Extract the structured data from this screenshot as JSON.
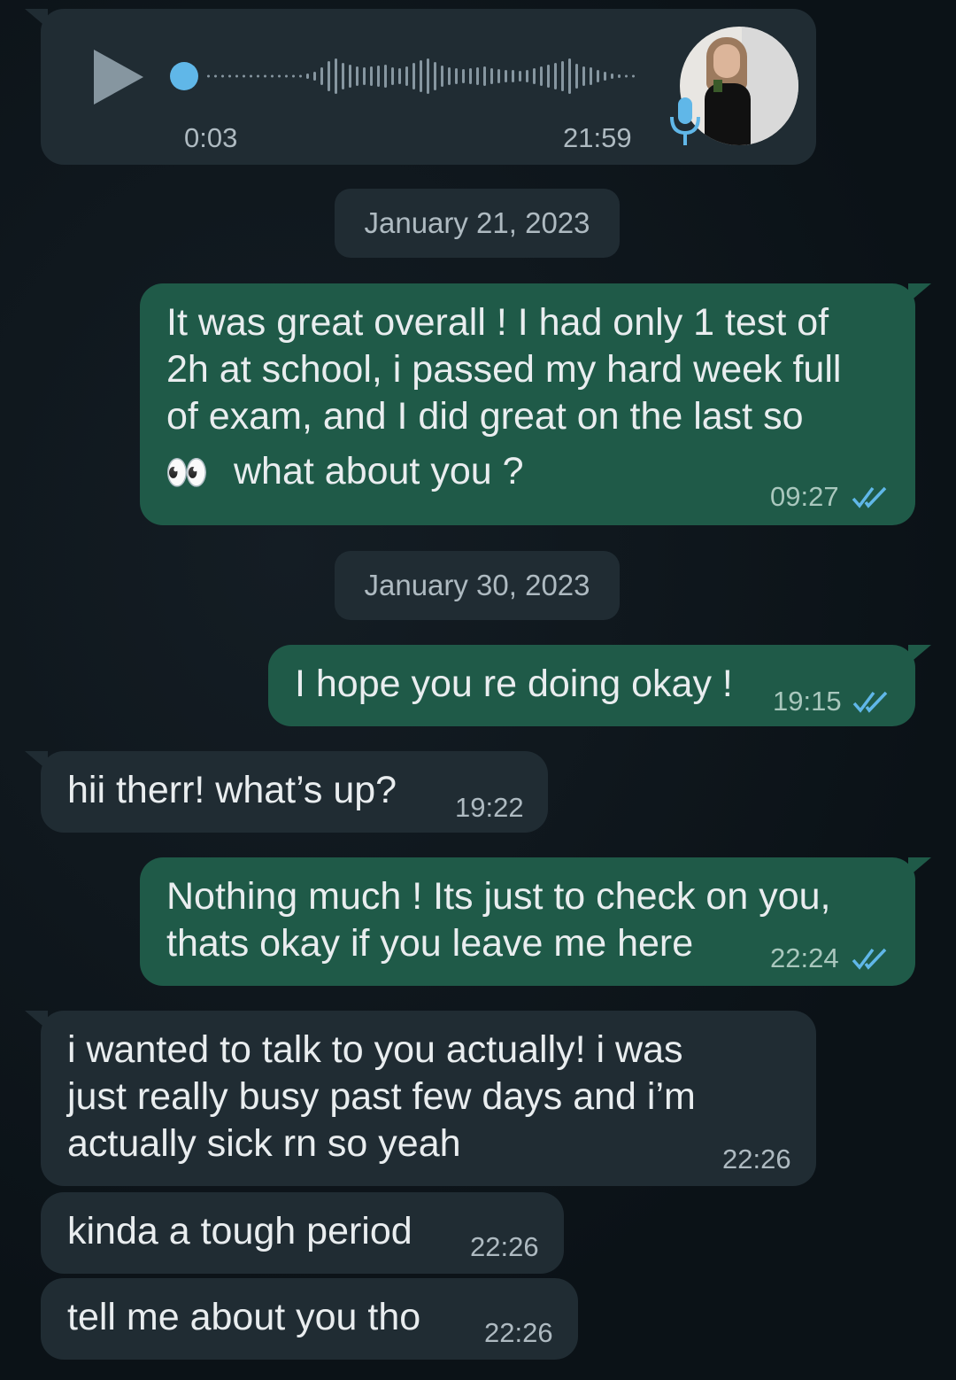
{
  "voice_message": {
    "duration": "0:03",
    "time": "21:59",
    "colors": {
      "accent": "#60b7e8",
      "bubble": "#202c33"
    },
    "icons": [
      "play-icon",
      "microphone-icon"
    ]
  },
  "date_separators": [
    "January 21, 2023",
    "January 30, 2023"
  ],
  "messages": [
    {
      "direction": "outgoing",
      "lines": [
        "It was great overall ! I had only 1 test of",
        "2h at school, i passed my hard week full",
        "of exam, and I did great on the last so",
        "what about you ?"
      ],
      "emoji": "👀",
      "time": "09:27",
      "status": "read"
    },
    {
      "direction": "outgoing",
      "text": "I hope you re doing okay !",
      "time": "19:15",
      "status": "read"
    },
    {
      "direction": "incoming",
      "text": "hii therr! what’s up?",
      "time": "19:22"
    },
    {
      "direction": "outgoing",
      "lines": [
        "Nothing much ! Its just to check on you,",
        "thats okay if you leave me here"
      ],
      "time": "22:24",
      "status": "read"
    },
    {
      "direction": "incoming",
      "lines": [
        "i wanted to talk to you actually! i was",
        "just really busy past few days and i’m",
        "actually sick rn so yeah"
      ],
      "time": "22:26"
    },
    {
      "direction": "incoming",
      "text": "kinda a tough period",
      "time": "22:26"
    },
    {
      "direction": "incoming",
      "text": "tell me about you tho",
      "time": "22:26"
    }
  ],
  "colors": {
    "background": "#0d141a",
    "incoming_bubble": "#202c33",
    "outgoing_bubble": "#1f5a48",
    "read_ticks": "#60b7e8"
  }
}
